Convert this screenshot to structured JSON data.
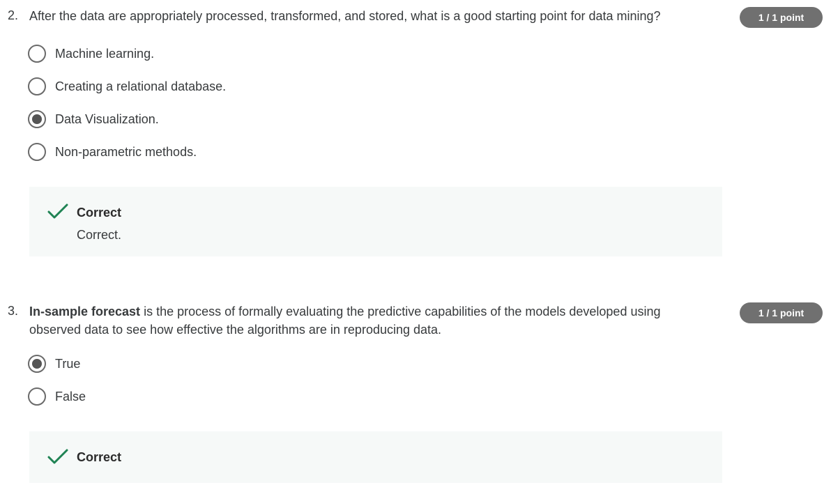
{
  "q2": {
    "number": "2.",
    "text": "After the data are appropriately processed, transformed, and stored, what is a good starting point for data mining?",
    "points": "1 / 1 point",
    "options": [
      {
        "label": "Machine learning.",
        "selected": false
      },
      {
        "label": "Creating a relational database.",
        "selected": false
      },
      {
        "label": "Data Visualization.",
        "selected": true
      },
      {
        "label": "Non-parametric methods.",
        "selected": false
      }
    ],
    "feedback": {
      "title": "Correct",
      "text": "Correct."
    }
  },
  "q3": {
    "number": "3.",
    "text_bold": "In-sample forecast",
    "text_rest": " is the process of formally evaluating the predictive capabilities of the models developed using observed data to see how effective the algorithms are in reproducing data.",
    "points": "1 / 1 point",
    "options": [
      {
        "label": "True",
        "selected": true
      },
      {
        "label": "False",
        "selected": false
      }
    ],
    "feedback": {
      "title": "Correct"
    }
  },
  "colors": {
    "check": "#1f8354",
    "badge": "#707070",
    "feedback_bg": "#f6f9f8"
  }
}
